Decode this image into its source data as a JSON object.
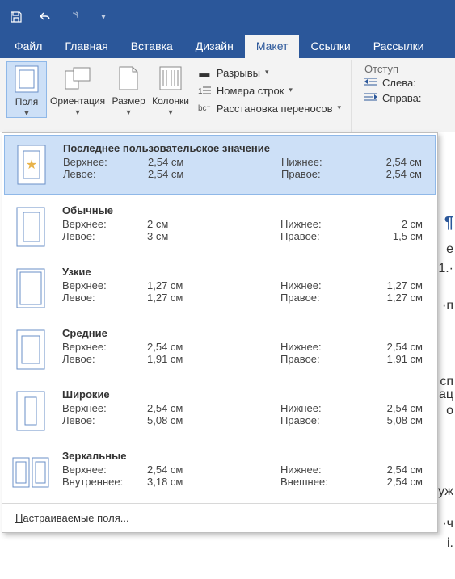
{
  "qat": {
    "save_title": "Сохранить",
    "undo_title": "Отменить",
    "redo_title": "Повторить"
  },
  "tabs": {
    "file": "Файл",
    "home": "Главная",
    "insert": "Вставка",
    "design": "Дизайн",
    "layout": "Макет",
    "references": "Ссылки",
    "mailings": "Рассылки"
  },
  "ribbon": {
    "margins": "Поля",
    "orientation": "Ориентация",
    "size": "Размер",
    "columns": "Колонки",
    "breaks": "Разрывы",
    "line_numbers": "Номера строк",
    "hyphenation": "Расстановка переносов",
    "indent_label": "Отступ",
    "indent_left": "Слева:",
    "indent_right": "Справа:"
  },
  "margins_dropdown": {
    "labels": {
      "top": "Верхнее:",
      "bottom": "Нижнее:",
      "left": "Левое:",
      "right": "Правое:",
      "inner": "Внутреннее:",
      "outer": "Внешнее:"
    },
    "options": [
      {
        "name": "Последнее пользовательское значение",
        "ico": "last",
        "top": "2,54 см",
        "bottom": "2,54 см",
        "left": "2,54 см",
        "right": "2,54 см",
        "l1": "top",
        "l2": "left",
        "r1": "bottom",
        "r2": "right",
        "selected": true
      },
      {
        "name": "Обычные",
        "ico": "normal",
        "top": "2 см",
        "bottom": "2 см",
        "left": "3 см",
        "right": "1,5 см",
        "l1": "top",
        "l2": "left",
        "r1": "bottom",
        "r2": "right"
      },
      {
        "name": "Узкие",
        "ico": "narrow",
        "top": "1,27 см",
        "bottom": "1,27 см",
        "left": "1,27 см",
        "right": "1,27 см",
        "l1": "top",
        "l2": "left",
        "r1": "bottom",
        "r2": "right"
      },
      {
        "name": "Средние",
        "ico": "moderate",
        "top": "2,54 см",
        "bottom": "2,54 см",
        "left": "1,91 см",
        "right": "1,91 см",
        "l1": "top",
        "l2": "left",
        "r1": "bottom",
        "r2": "right"
      },
      {
        "name": "Широкие",
        "ico": "wide",
        "top": "2,54 см",
        "bottom": "2,54 см",
        "left": "5,08 см",
        "right": "5,08 см",
        "l1": "top",
        "l2": "left",
        "r1": "bottom",
        "r2": "right"
      },
      {
        "name": "Зеркальные",
        "ico": "mirrored",
        "top": "2,54 см",
        "bottom": "2,54 см",
        "left": "3,18 см",
        "right": "2,54 см",
        "l1": "top",
        "l2": "inner",
        "r1": "bottom",
        "r2": "outer"
      }
    ],
    "custom": "Настраиваемые поля..."
  },
  "docfrags": [
    "¶",
    "е",
    "1.·",
    "·п",
    "сп",
    "ац",
    "о",
    "уж",
    "·ч",
    "і."
  ]
}
